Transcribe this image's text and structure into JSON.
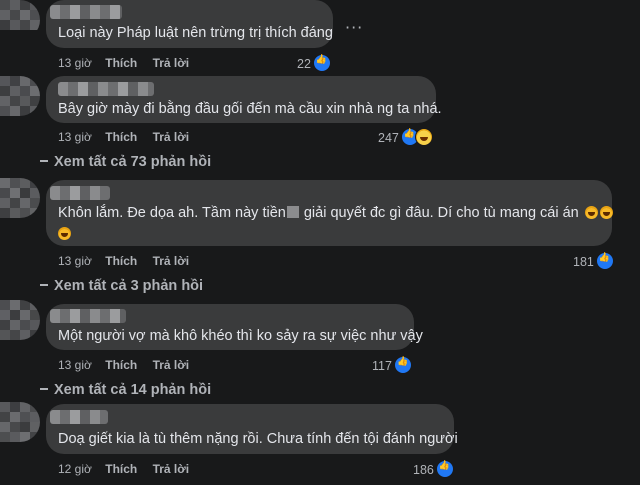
{
  "comments": [
    {
      "text": "Loại này Pháp luật nên trừng trị thích đáng",
      "time": "13 giờ",
      "like_label": "Thích",
      "reply_label": "Trả lời",
      "reaction_count": "22",
      "reactions": [
        "like"
      ],
      "more_icon": "ellipsis-icon"
    },
    {
      "text": "Bây giờ mày đi bằng đầu gối đến mà cầu xin nhà ng ta nhá.",
      "time": "13 giờ",
      "like_label": "Thích",
      "reply_label": "Trả lời",
      "reaction_count": "247",
      "reactions": [
        "like",
        "haha"
      ],
      "view_replies": "Xem tất cả 73 phản hồi"
    },
    {
      "text_before": "Khôn lắm. Đe dọa ah. Tầm này tiền",
      "text_after": " giải quyết đc gì đâu. Dí cho tù mang cái án",
      "time": "13 giờ",
      "like_label": "Thích",
      "reply_label": "Trả lời",
      "reaction_count": "181",
      "reactions": [
        "like"
      ],
      "view_replies": "Xem tất cả 3 phản hồi"
    },
    {
      "text": "Một người vợ mà khô khéo thì ko sảy ra sự việc như vậy",
      "time": "13 giờ",
      "like_label": "Thích",
      "reply_label": "Trả lời",
      "reaction_count": "117",
      "reactions": [
        "like"
      ],
      "view_replies": "Xem tất cả 14 phản hồi"
    },
    {
      "text": "Doạ giết kia là tù thêm nặng rồi. Chưa tính đến tội đánh người",
      "time": "12 giờ",
      "like_label": "Thích",
      "reply_label": "Trả lời",
      "reaction_count": "186",
      "reactions": [
        "like"
      ]
    }
  ],
  "colors": {
    "background": "#18191a",
    "bubble": "#3a3b3c",
    "text": "#e4e6eb",
    "secondary": "#b0b3b8",
    "like_blue": "#2078f4"
  }
}
